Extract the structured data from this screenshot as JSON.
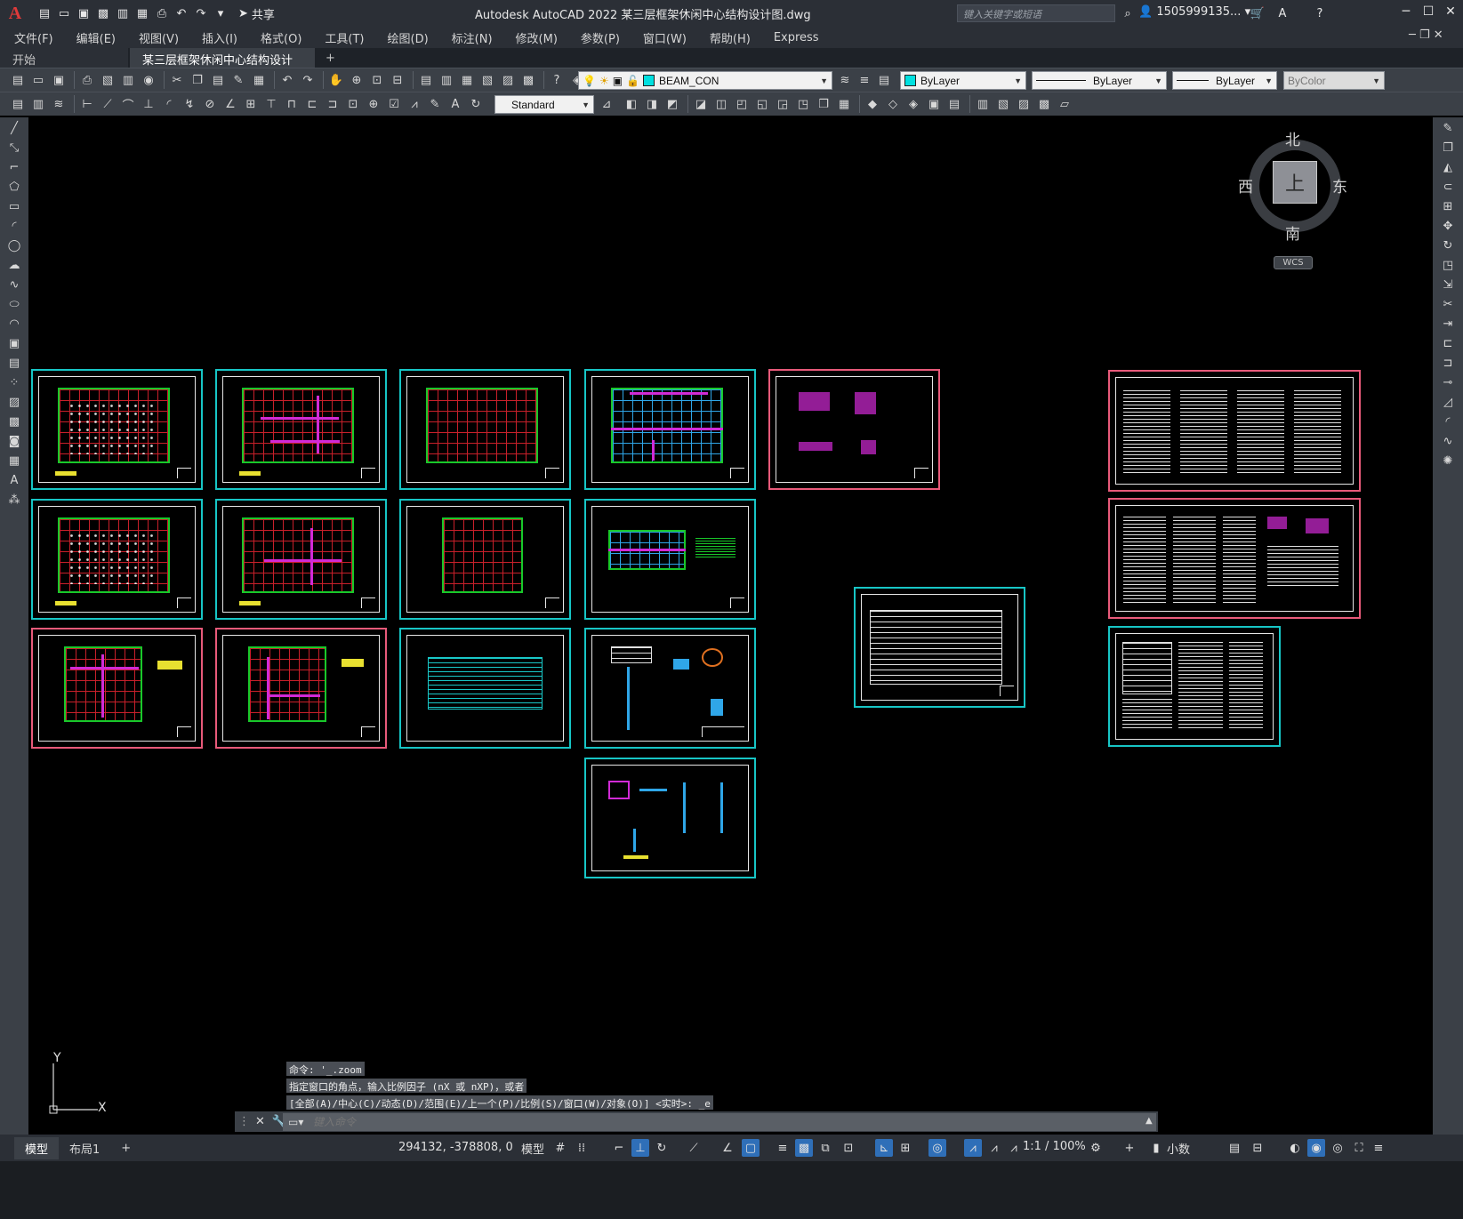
{
  "app": {
    "title": "Autodesk AutoCAD 2022    某三层框架休闲中心结构设计图.dwg",
    "logo": "A",
    "share_label": "共享",
    "search_placeholder": "键入关键字或短语",
    "user_label": "1505999135...",
    "help_icon": "?"
  },
  "menus": [
    "文件(F)",
    "编辑(E)",
    "视图(V)",
    "插入(I)",
    "格式(O)",
    "工具(T)",
    "绘图(D)",
    "标注(N)",
    "修改(M)",
    "参数(P)",
    "窗口(W)",
    "帮助(H)",
    "Express"
  ],
  "file_tabs": [
    {
      "label": "开始",
      "active": false
    },
    {
      "label": "某三层框架休闲中心结构设计图*",
      "active": true
    }
  ],
  "toolbar": {
    "layer_name": "BEAM_CON",
    "layer_color": "#00e0e0",
    "color_value": "ByLayer",
    "linetype_value": "ByLayer",
    "lineweight_value": "ByLayer",
    "plotstyle_value": "ByColor",
    "textstyle_value": "Standard"
  },
  "navcube": {
    "north": "北",
    "south": "南",
    "east": "东",
    "west": "西",
    "face": "上",
    "wcs": "WCS"
  },
  "ucs": {
    "x": "X",
    "y": "Y"
  },
  "command": {
    "history": [
      "命令: '_.zoom",
      "指定窗口的角点，输入比例因子 (nX 或 nXP)，或者",
      "[全部(A)/中心(C)/动态(D)/范围(E)/上一个(P)/比例(S)/窗口(W)/对象(O)] <实时>: _e"
    ],
    "placeholder": "键入命令"
  },
  "status": {
    "layout_tabs": [
      "模型",
      "布局1"
    ],
    "coordinates": "294132, -378808, 0",
    "model_label": "模型",
    "scale": "1:1 / 100%",
    "units": "小数"
  }
}
